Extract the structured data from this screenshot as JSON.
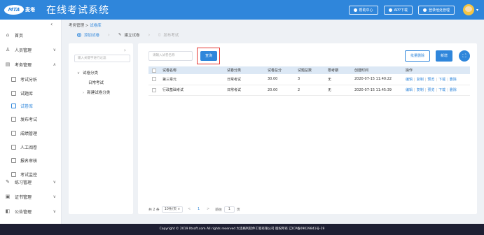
{
  "header": {
    "logo_mark": "MTA",
    "logo_name": "麦塔",
    "title": "在线考试系统",
    "buttons": [
      {
        "label": "帮助中心",
        "icon": "help-icon"
      },
      {
        "label": "APP下载",
        "icon": "download-icon"
      },
      {
        "label": "登录他处管理",
        "icon": "user-icon"
      }
    ]
  },
  "sidebar": {
    "items": [
      {
        "label": "首页",
        "icon": "home-icon"
      },
      {
        "label": "人员管理",
        "icon": "user-icon",
        "chevron": "∨"
      },
      {
        "label": "考务管理",
        "icon": "exam-icon",
        "chevron": "∧"
      },
      {
        "label": "考试分析",
        "icon": "analysis-icon"
      },
      {
        "label": "试题库",
        "icon": "question-bank-icon"
      },
      {
        "label": "试卷库",
        "icon": "paper-bank-icon"
      },
      {
        "label": "发布考试",
        "icon": "publish-icon"
      },
      {
        "label": "成绩管理",
        "icon": "score-icon"
      },
      {
        "label": "人工阅卷",
        "icon": "grading-icon"
      },
      {
        "label": "报名审核",
        "icon": "review-icon"
      },
      {
        "label": "考试监控",
        "icon": "monitor-icon"
      },
      {
        "label": "练习管理",
        "icon": "practice-icon",
        "chevron": "∨"
      },
      {
        "label": "证书管理",
        "icon": "certificate-icon",
        "chevron": "∨"
      },
      {
        "label": "公告管理",
        "icon": "notice-icon",
        "chevron": "∨"
      }
    ]
  },
  "breadcrumb": {
    "parent": "考务管理",
    "sep": ">",
    "current": "试卷库"
  },
  "steps": [
    {
      "label": "添加试卷"
    },
    {
      "label": "建立试卷"
    },
    {
      "label": "发布考试"
    }
  ],
  "tree": {
    "search_placeholder": "输入关键字进行过滤",
    "root": "试卷分类",
    "child1": "日常考试",
    "child2": "新建试卷分类"
  },
  "toolbar": {
    "search_placeholder": "请输入试卷名称",
    "query_label": "查询",
    "batch_delete_label": "批量删除",
    "new_label": "新增"
  },
  "table": {
    "headers": [
      "试卷名称",
      "试卷分类",
      "试卷总分",
      "试题总数",
      "限考期",
      "创建时间",
      "操作"
    ],
    "rows": [
      {
        "name": "第三章元",
        "category": "日常考试",
        "score": "30.00",
        "count": "3",
        "limit": "无",
        "created": "2020-07-15 11:40:22"
      },
      {
        "name": "行政基础考试",
        "category": "日常考试",
        "score": "20.00",
        "count": "2",
        "limit": "无",
        "created": "2020-07-15 11:45:39"
      }
    ],
    "ops": [
      "编辑",
      "复制",
      "预览",
      "下载",
      "删除"
    ]
  },
  "pagination": {
    "total": "共 2 条",
    "per_page": "10条/页",
    "prev": "<",
    "page": "1",
    "next": ">",
    "goto_label": "前往",
    "goto_value": "1",
    "goto_suffix": "页"
  },
  "footer": {
    "text": "Copyright © 2019 lltsoft.com All rights reserved 大连格利软件工程有限公司 版权所有 辽ICP备09029841号-19"
  },
  "colors": {
    "primary": "#2f86db",
    "header": "#2f86db",
    "footer": "#1e1f33",
    "highlight": "#e53935"
  }
}
